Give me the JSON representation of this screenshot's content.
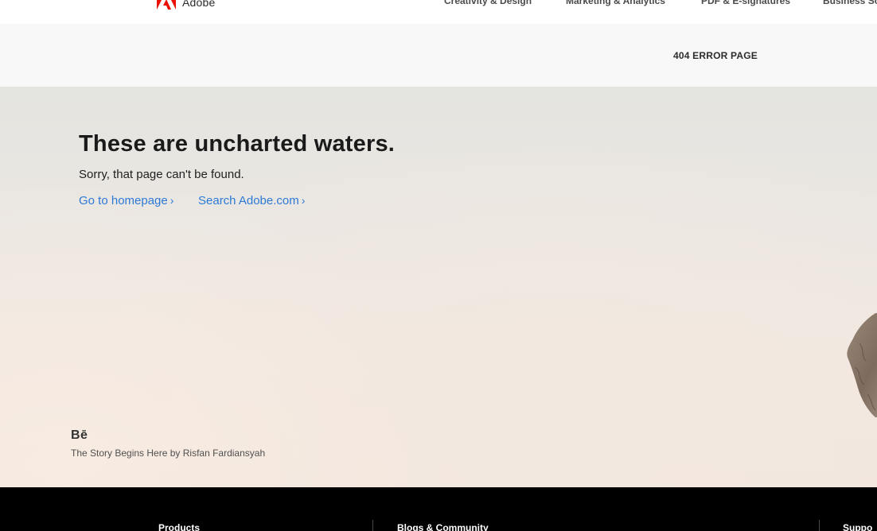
{
  "header": {
    "brand_name": "Adobe",
    "brand_icon": "adobe-logo-icon",
    "nav": [
      {
        "label": "Creativity & Design"
      },
      {
        "label": "Marketing & Analytics"
      },
      {
        "label": "PDF & E-signatures"
      },
      {
        "label": "Business So"
      }
    ]
  },
  "subnav": {
    "title": "404 ERROR PAGE"
  },
  "hero": {
    "title": "These are uncharted waters.",
    "subtitle": "Sorry, that page can't be found.",
    "links": [
      {
        "label": "Go to homepage",
        "chevron": "›"
      },
      {
        "label": "Search Adobe.com",
        "chevron": "›"
      }
    ],
    "credit": {
      "icon_text": "Bē",
      "icon": "behance-icon",
      "text": "The Story Begins Here by Risfan Fardiansyah"
    }
  },
  "footer": {
    "columns": [
      {
        "label": "Products"
      },
      {
        "label": "Blogs & Community"
      },
      {
        "label": "Suppo"
      }
    ]
  },
  "colors": {
    "brand_red": "#eb1000",
    "link_blue": "#2c7ad6",
    "footer_bg": "#000000",
    "subnav_bg": "#f8f8f8"
  }
}
